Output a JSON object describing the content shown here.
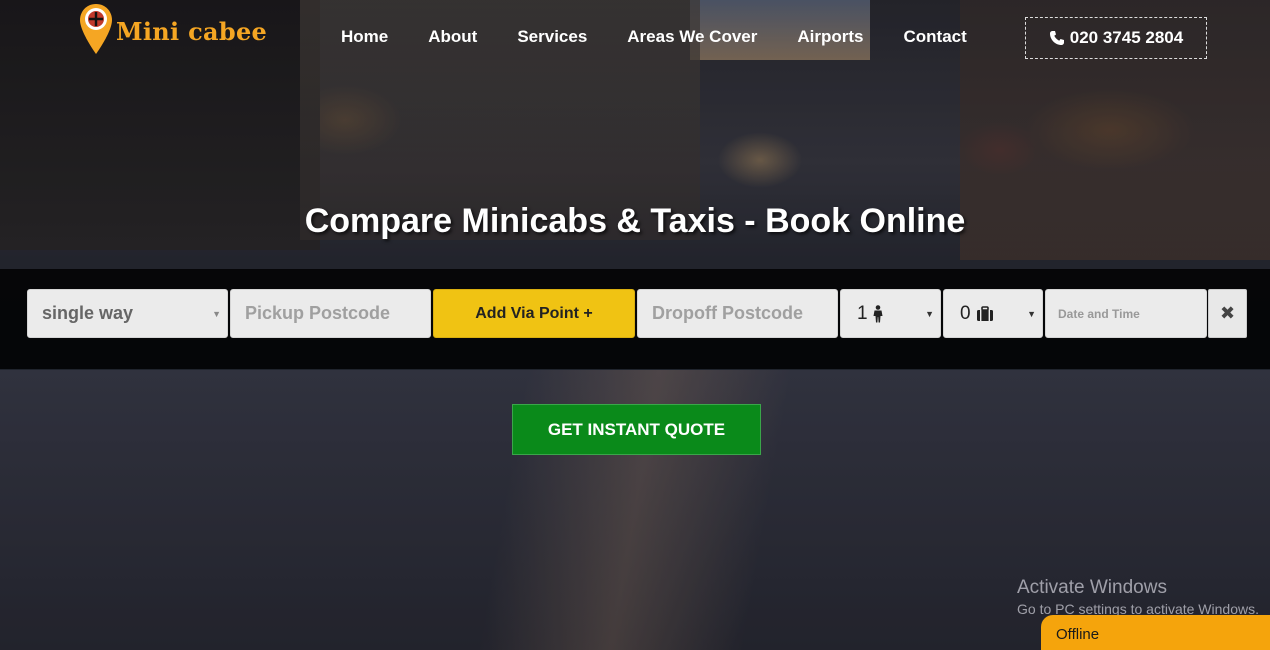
{
  "brand": {
    "name": "Mini cabee",
    "accent": "#f5a623"
  },
  "nav": {
    "items": [
      {
        "label": "Home"
      },
      {
        "label": "About"
      },
      {
        "label": "Services"
      },
      {
        "label": "Areas We Cover"
      },
      {
        "label": "Airports"
      },
      {
        "label": "Contact"
      }
    ],
    "phone": "020 3745 2804",
    "phone_icon": "phone-icon"
  },
  "hero": {
    "title": "Compare Minicabs & Taxis - Book Online"
  },
  "booking": {
    "trip_type": "single way",
    "pickup_placeholder": "Pickup Postcode",
    "via_label": "Add Via Point +",
    "dropoff_placeholder": "Dropoff Postcode",
    "passengers": "1",
    "passenger_icon": "person-icon",
    "luggage": "0",
    "luggage_icon": "luggage-icon",
    "datetime_placeholder": "Date and Time",
    "clear_label": "✖",
    "via_color": "#f0c313"
  },
  "cta": {
    "label": "GET INSTANT QUOTE",
    "color": "#0a8a1a"
  },
  "watermark": {
    "title": "Activate Windows",
    "subtitle": "Go to PC settings to activate Windows."
  },
  "chat": {
    "status": "Offline",
    "color": "#f5a40c"
  }
}
